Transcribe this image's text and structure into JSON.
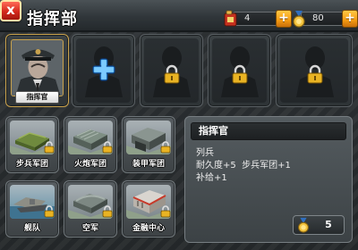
{
  "header": {
    "close_label": "x",
    "title": "指挥部",
    "resources": [
      {
        "name": "fuel",
        "icon": "fuel-can-icon",
        "value": "4"
      },
      {
        "name": "medal",
        "icon": "medal-icon",
        "value": "80"
      }
    ],
    "add_label": "+"
  },
  "slots": [
    {
      "label": "指挥官",
      "state": "commander",
      "icon": "officer-portrait"
    },
    {
      "state": "add",
      "icon": "plus-icon"
    },
    {
      "state": "locked",
      "icon": "lock-icon"
    },
    {
      "state": "locked",
      "icon": "lock-icon"
    },
    {
      "state": "locked",
      "icon": "lock-icon"
    }
  ],
  "buildings": [
    {
      "label": "步兵军团",
      "icon": "infantry-building-icon",
      "locked": true
    },
    {
      "label": "火炮军团",
      "icon": "artillery-building-icon",
      "locked": true
    },
    {
      "label": "装甲军团",
      "icon": "armor-building-icon",
      "locked": true
    },
    {
      "label": "舰队",
      "icon": "fleet-building-icon",
      "locked": true
    },
    {
      "label": "空军",
      "icon": "airforce-building-icon",
      "locked": true
    },
    {
      "label": "金融中心",
      "icon": "finance-building-icon",
      "locked": true
    }
  ],
  "info": {
    "title": "指挥官",
    "lines": [
      "列兵",
      "耐久度+5  步兵军团+1",
      "补给+1"
    ],
    "cost": "5",
    "cost_icon": "medal-icon"
  },
  "colors": {
    "accent_orange": "#f39a12",
    "close_red": "#d4291c",
    "frame_gold": "#c9a24d"
  }
}
